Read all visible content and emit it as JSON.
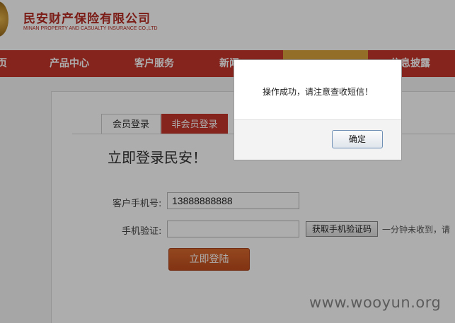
{
  "header": {
    "brand_cn": "民安财产保险有限公司",
    "brand_en": "MINAN PROPERTY AND CASUALTY INSURANCE CO.,LTD"
  },
  "nav": {
    "items": [
      {
        "label": "页"
      },
      {
        "label": "产品中心"
      },
      {
        "label": "客户服务"
      },
      {
        "label": "新闻"
      },
      {
        "label": ""
      },
      {
        "label": "信息披露"
      }
    ]
  },
  "login": {
    "tabs": [
      {
        "label": "会员登录"
      },
      {
        "label": "非会员登录"
      }
    ],
    "title": "立即登录民安！",
    "phone_label": "客户手机号:",
    "phone_value": "13888888888",
    "code_label": "手机验证:",
    "code_value": "",
    "sms_button": "获取手机验证码",
    "sms_hint": "一分钟未收到，请",
    "submit": "立即登陆"
  },
  "dialog": {
    "message": "操作成功，请注意查收短信！",
    "ok": "确定"
  },
  "watermark": "www.wooyun.org",
  "colors": {
    "brand_red": "#c5342b",
    "nav_highlight": "#d8a23d",
    "login_button": "#c9561f"
  }
}
